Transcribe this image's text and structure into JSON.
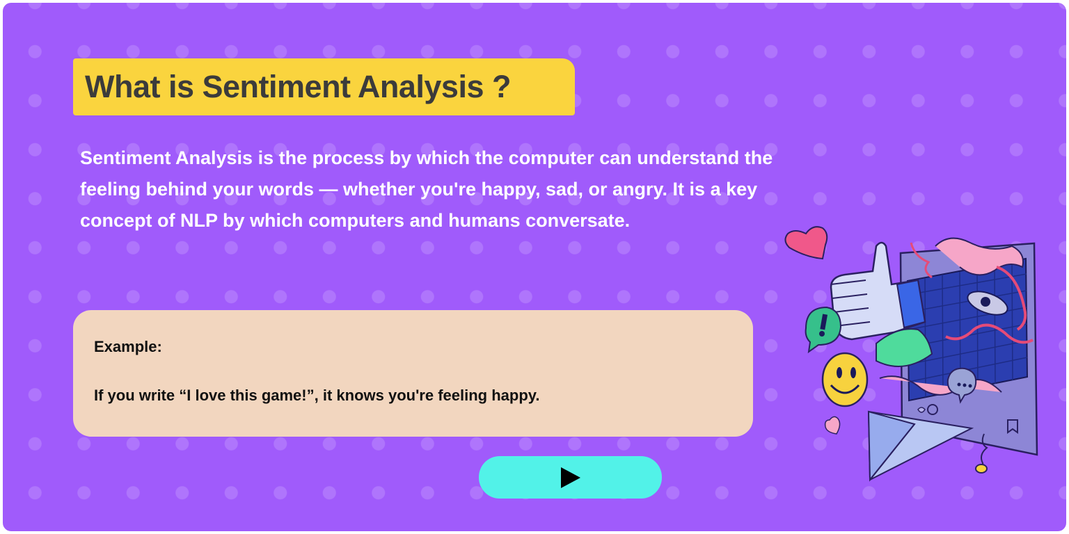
{
  "lesson": {
    "title": "What is Sentiment Analysis ?",
    "description": "Sentiment Analysis is the process by which the  computer can understand the feeling behind your words — whether you're happy, sad, or angry. It is a key concept of NLP by which computers and humans conversate.",
    "example": {
      "label": "Example:",
      "text": "If you write “I love this game!”, it knows you're feeling happy."
    },
    "play_button": {
      "icon": "play-icon"
    },
    "illustration": {
      "icons": [
        "heart-icon",
        "thumbs-up-icon",
        "exclamation-bubble-icon",
        "smiley-icon",
        "chat-bubble-icon",
        "paper-plane-icon",
        "bookmark-icon"
      ]
    }
  },
  "colors": {
    "background": "#a05bfb",
    "title_box": "#fad43e",
    "title_text": "#3b3b3b",
    "example_box": "#f2d6bf",
    "play_button": "#52f2e8"
  }
}
